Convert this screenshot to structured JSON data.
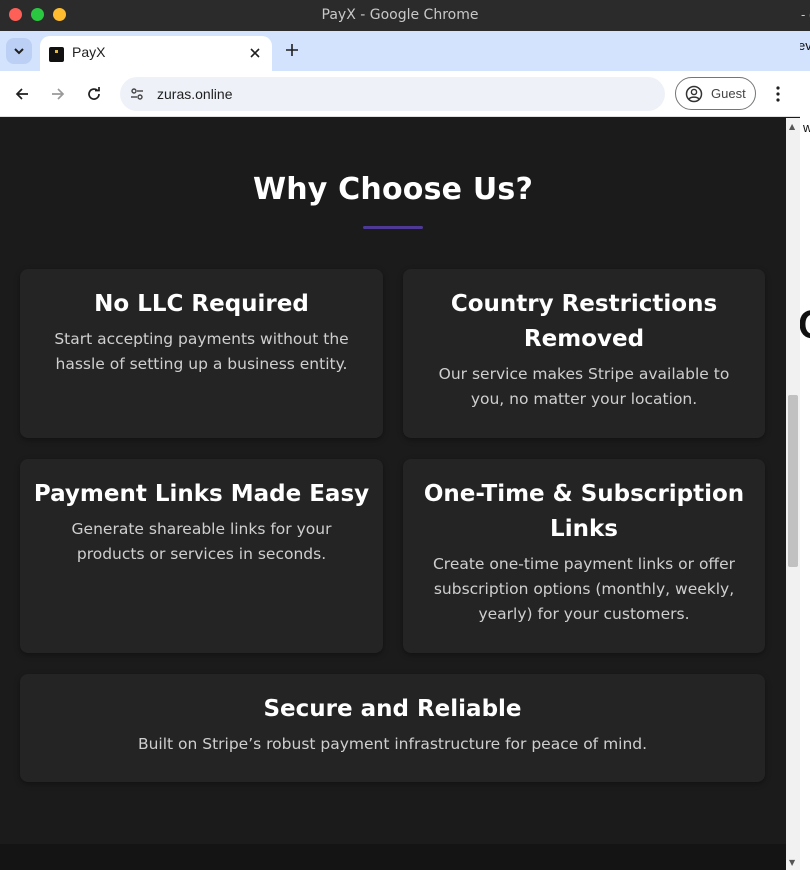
{
  "window": {
    "title": "PayX - Google Chrome"
  },
  "tabs": {
    "active_label": "PayX",
    "close_glyph": "✕",
    "new_tab_glyph": "+",
    "list_glyph": "⌄"
  },
  "toolbar": {
    "url": "zuras.online",
    "profile_label": "Guest",
    "menu_glyph": "⋮"
  },
  "background_window": {
    "fragments": [
      "- (",
      "ev",
      "w",
      "C"
    ]
  },
  "page": {
    "heading": "Why Choose Us?",
    "cards": [
      {
        "title": "No LLC Required",
        "description": "Start accepting payments without the hassle of setting up a business entity."
      },
      {
        "title": "Country Restrictions Removed",
        "description": "Our service makes Stripe available to you, no matter your location."
      },
      {
        "title": "Payment Links Made Easy",
        "description": "Generate shareable links for your products or services in seconds."
      },
      {
        "title": "One-Time & Subscription Links",
        "description": "Create one-time payment links or offer subscription options (monthly, weekly, yearly) for your customers."
      },
      {
        "title": "Secure and Reliable",
        "description": "Built on Stripe’s robust payment infrastructure for peace of mind."
      }
    ]
  },
  "scrollbar": {
    "up_glyph": "▲",
    "down_glyph": "▼"
  },
  "colors": {
    "page_background": "#1b1b1b",
    "card_background": "#242424",
    "accent_underline": "#4e3a96",
    "tab_strip": "#d3e3fd"
  }
}
